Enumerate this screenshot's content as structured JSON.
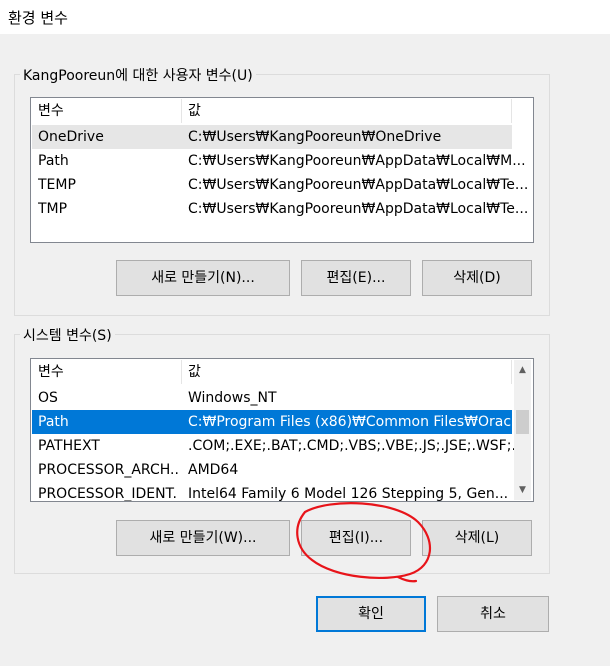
{
  "window": {
    "title": "환경 변수"
  },
  "user_vars": {
    "group_label": "KangPooreun에 대한 사용자 변수(U)",
    "columns": [
      "변수",
      "값"
    ],
    "rows": [
      {
        "name": "OneDrive",
        "value": "C:₩Users₩KangPooreun₩OneDrive"
      },
      {
        "name": "Path",
        "value": "C:₩Users₩KangPooreun₩AppData₩Local₩M..."
      },
      {
        "name": "TEMP",
        "value": "C:₩Users₩KangPooreun₩AppData₩Local₩Te..."
      },
      {
        "name": "TMP",
        "value": "C:₩Users₩KangPooreun₩AppData₩Local₩Te..."
      }
    ],
    "buttons": {
      "new": "새로 만들기(N)...",
      "edit": "편집(E)...",
      "delete": "삭제(D)"
    }
  },
  "system_vars": {
    "group_label": "시스템 변수(S)",
    "columns": [
      "변수",
      "값"
    ],
    "rows": [
      {
        "name": "OS",
        "value": "Windows_NT"
      },
      {
        "name": "Path",
        "value": "C:₩Program Files (x86)₩Common Files₩Orac..."
      },
      {
        "name": "PATHEXT",
        "value": ".COM;.EXE;.BAT;.CMD;.VBS;.VBE;.JS;.JSE;.WSF;..."
      },
      {
        "name": "PROCESSOR_ARCH...",
        "value": "AMD64"
      },
      {
        "name": "PROCESSOR_IDENT...",
        "value": "Intel64 Family 6 Model 126 Stepping 5, Gen..."
      }
    ],
    "buttons": {
      "new": "새로 만들기(W)...",
      "edit": "편집(I)...",
      "delete": "삭제(L)"
    }
  },
  "footer": {
    "ok": "확인",
    "cancel": "취소"
  },
  "colors": {
    "selection": "#0078d7",
    "annotation": "#e8141a"
  }
}
